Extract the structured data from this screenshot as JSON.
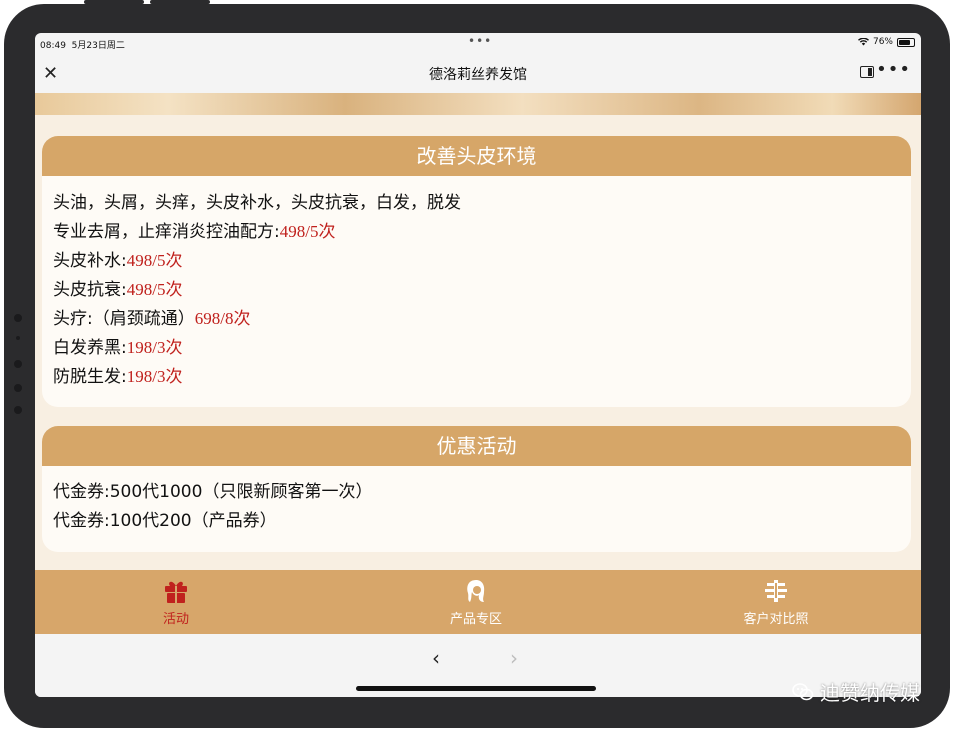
{
  "status": {
    "time": "08:49",
    "date": "5月23日周二",
    "battery": "76%",
    "dots": "•••"
  },
  "navbar": {
    "close": "✕",
    "title": "德洛莉丝养发馆",
    "more": "•••"
  },
  "cards": [
    {
      "header": "改善头皮环境",
      "lines": [
        {
          "text": "头油，头屑，头痒，头皮补水，头皮抗衰，白发，脱发",
          "price": ""
        },
        {
          "text": "专业去屑，止痒消炎控油配方:",
          "price": "498/5次"
        },
        {
          "text": "头皮补水:",
          "price": "498/5次"
        },
        {
          "text": "头皮抗衰:",
          "price": "498/5次"
        },
        {
          "text": "头疗:（肩颈疏通）",
          "price": "698/8次"
        },
        {
          "text": "白发养黑:",
          "price": "198/3次"
        },
        {
          "text": "防脱生发:",
          "price": "198/3次"
        }
      ]
    },
    {
      "header": "优惠活动",
      "lines": [
        {
          "text": "代金券:500代1000（只限新顾客第一次）",
          "price": ""
        },
        {
          "text": "代金券:100代200（产品券）",
          "price": ""
        }
      ]
    }
  ],
  "tabs": [
    {
      "label": "活动",
      "icon": "gift-icon",
      "active": true
    },
    {
      "label": "产品专区",
      "icon": "woman-profile-icon",
      "active": false
    },
    {
      "label": "客户对比照",
      "icon": "compare-icon",
      "active": false
    }
  ],
  "browser": {
    "back": "‹",
    "forward": "›"
  },
  "watermark": {
    "text": "迪赞纳传媒",
    "icon": "wechat-icon"
  },
  "colors": {
    "accent": "#d6a668",
    "price": "#c0211d",
    "active_tab": "#c0211d",
    "card_bg": "#fefbf6"
  }
}
